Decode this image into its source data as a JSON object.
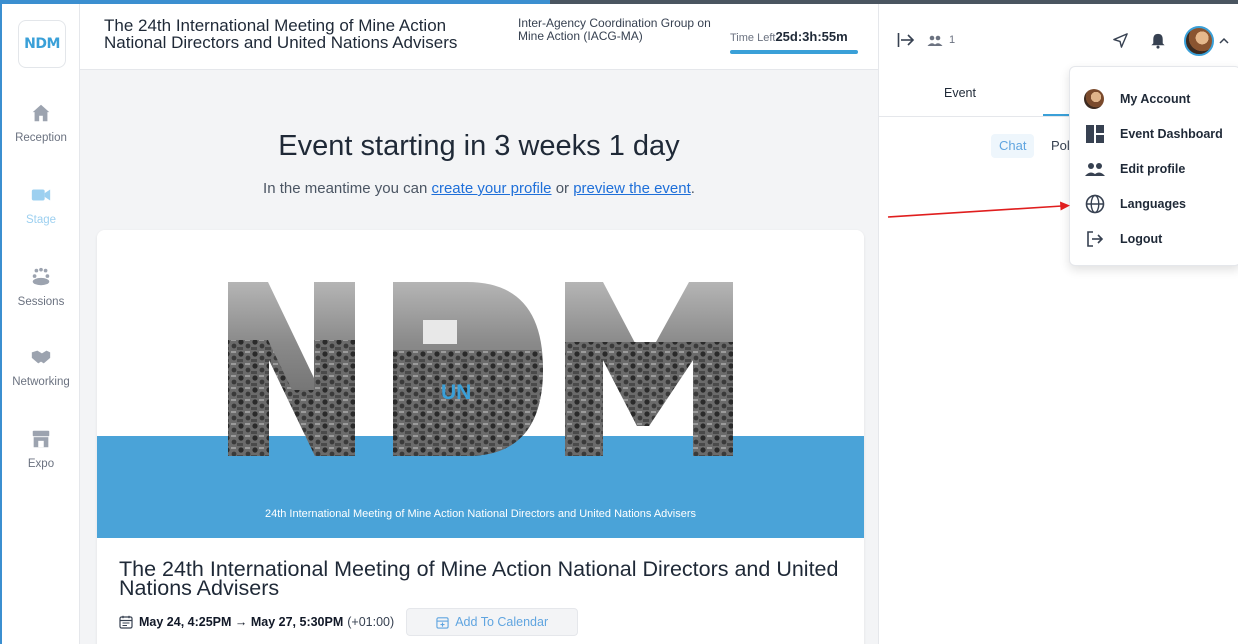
{
  "header": {
    "event_title": "The 24th International Meeting of Mine Action National Directors and United Nations Advisers",
    "organizer": "Inter-Agency Coordination Group on Mine Action (IACG-MA)",
    "time_left_label": "Time Left",
    "time_left_value": "25d:3h:55m"
  },
  "nav": {
    "logo": "NDM",
    "items": [
      {
        "label": "Reception",
        "icon": "home-icon"
      },
      {
        "label": "Stage",
        "icon": "video-camera-icon",
        "active": true
      },
      {
        "label": "Sessions",
        "icon": "people-group-icon"
      },
      {
        "label": "Networking",
        "icon": "handshake-icon"
      },
      {
        "label": "Expo",
        "icon": "booth-icon"
      }
    ]
  },
  "main": {
    "countdown": "Event starting in 3 weeks 1 day",
    "meantime_prefix": "In the meantime you can",
    "link_profile": "create your profile",
    "meantime_or": "or",
    "link_preview": "preview the event",
    "meantime_suffix": ".",
    "banner": {
      "un_mark": "UN",
      "caption": "24th International Meeting of Mine Action National Directors and United Nations Advisers",
      "band_color": "#4aa3d8"
    },
    "card_title": "The 24th International Meeting of Mine Action National Directors and United Nations Advisers",
    "date_range": "May 24, 4:25PM → May 27, 5:30PM",
    "timezone": "(+01:00)",
    "add_calendar": "Add To Calendar"
  },
  "right_panel": {
    "attendee_count": "1",
    "tab_event": "Event",
    "subtab_chat": "Chat",
    "subtab_poll": "Poll"
  },
  "user_menu": {
    "items": [
      {
        "label": "My Account",
        "icon": "avatar"
      },
      {
        "label": "Event Dashboard",
        "icon": "dashboard-icon"
      },
      {
        "label": "Edit profile",
        "icon": "people-icon"
      },
      {
        "label": "Languages",
        "icon": "globe-icon"
      },
      {
        "label": "Logout",
        "icon": "logout-icon"
      }
    ]
  },
  "colors": {
    "accent": "#3aa0d8",
    "link": "#1e6fd9",
    "annotation_arrow": "#e01e1e"
  }
}
